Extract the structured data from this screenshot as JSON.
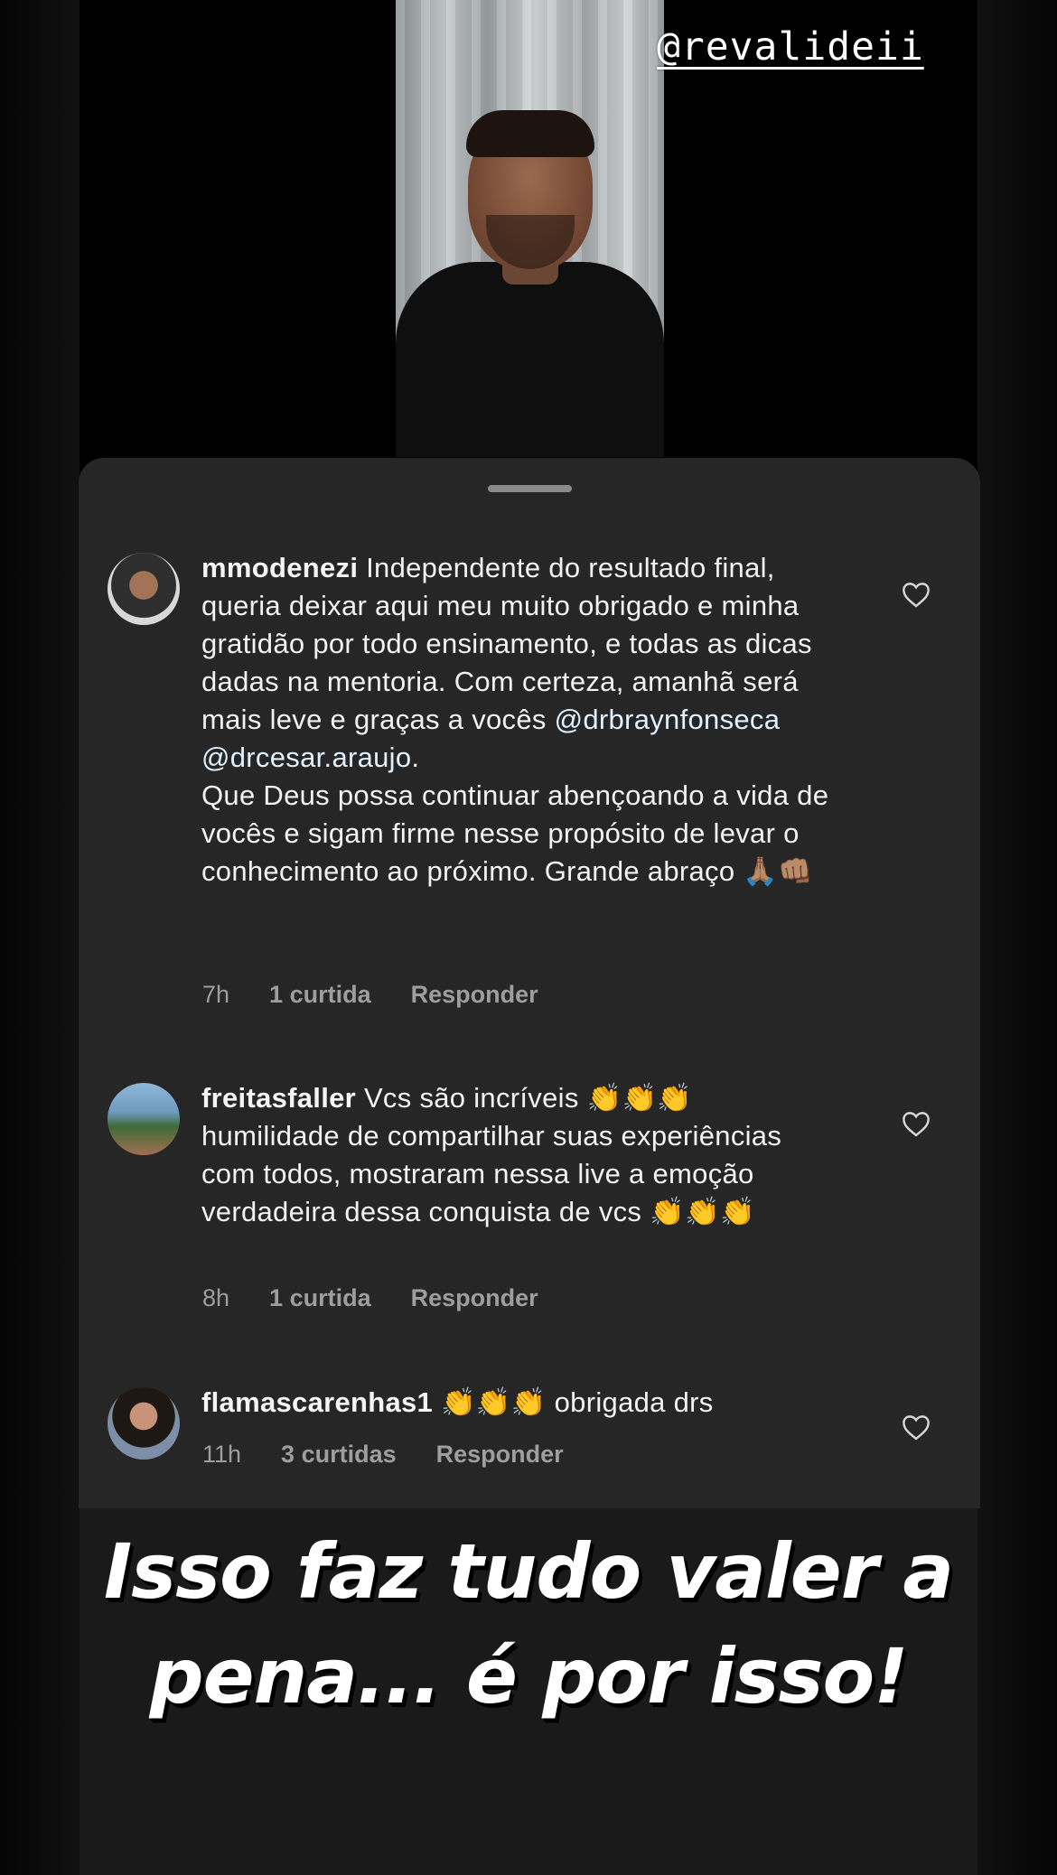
{
  "story": {
    "handle": "@revalideii",
    "caption_line1": "Isso faz tudo valer a",
    "caption_line2": "pena... é por isso!"
  },
  "comments": [
    {
      "username": "mmodenezi",
      "text_part1": " Independente do resultado final, queria deixar aqui meu muito obrigado e minha gratidão por todo ensinamento, e todas as dicas dadas na mentoria. Com certeza, amanhã será mais leve e graças a vocês ",
      "mention1": "@drbraynfonseca",
      "mention2": "@drcesar.araujo",
      "text_part2": ".\nQue Deus possa continuar abençoando a vida de vocês e sigam firme nesse propósito de levar o conhecimento ao próximo. Grande abraço 🙏🏽👊🏽",
      "time": "7h",
      "likes": "1 curtida",
      "reply": "Responder"
    },
    {
      "username": "freitasfaller",
      "text": " Vcs são incríveis 👏👏👏 humilidade de compartilhar suas experiências com todos, mostraram nessa live a emoção verdadeira dessa conquista de vcs 👏👏👏",
      "time": "8h",
      "likes": "1 curtida",
      "reply": "Responder"
    },
    {
      "username": "flamascarenhas1",
      "text": " 👏👏👏 obrigada drs",
      "time": "11h",
      "likes": "3 curtidas",
      "reply": "Responder"
    }
  ],
  "icons": {
    "like": "heart-outline-icon"
  },
  "colors": {
    "sheet": "#262626",
    "mention": "#e0f1ff",
    "meta": "#9e9e9e"
  }
}
